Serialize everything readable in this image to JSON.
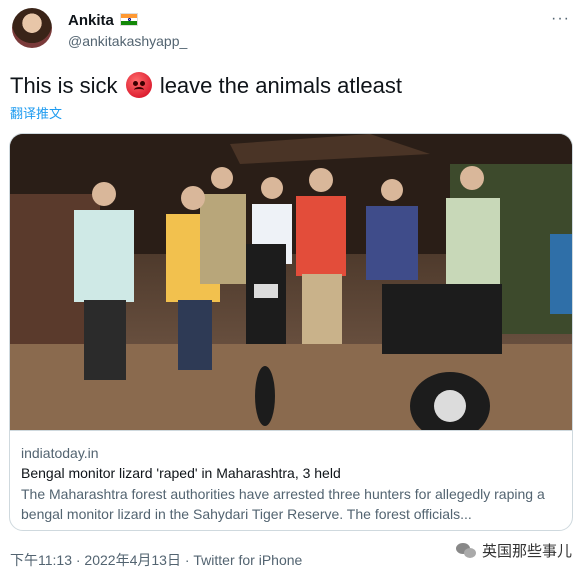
{
  "tweet": {
    "author": {
      "display_name": "Ankita",
      "flag_icon": "india-flag-icon",
      "handle": "@ankitakashyapp_"
    },
    "text_before": "This is sick",
    "emoji_icon": "angry-face-icon",
    "text_after": "leave the animals atleast",
    "translate_label": "翻译推文",
    "timestamp": "下午11:13 · 2022年4月13日 · Twitter for iPhone"
  },
  "card": {
    "image_icon": "news-photo",
    "domain": "indiatoday.in",
    "title": "Bengal monitor lizard 'raped' in Maharashtra, 3 held",
    "description": "The Maharashtra forest authorities have arrested three hunters for allegedly raping a bengal monitor lizard in the Sahydari Tiger Reserve. The forest officials..."
  },
  "watermark": {
    "icon": "wechat-icon",
    "label": "英国那些事儿"
  },
  "colors": {
    "link": "#1d9bf0",
    "secondary_text": "#536471",
    "border": "#cfd9de"
  }
}
